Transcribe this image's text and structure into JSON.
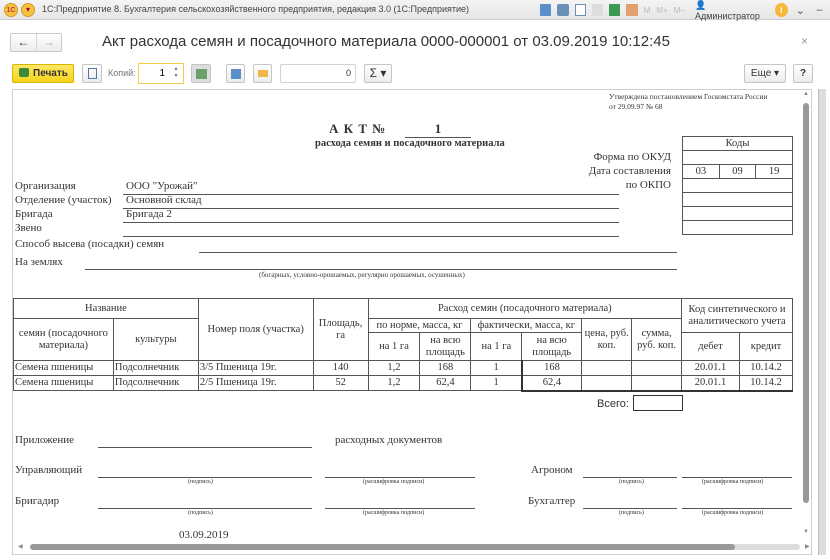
{
  "window": {
    "title": "1С:Предприятие 8. Бухгалтерия сельскохозяйственного предприятия, редакция 3.0  (1С:Предприятие)",
    "user": "Администратор",
    "m": "M",
    "m_plus": "M+",
    "m_minus": "M−"
  },
  "nav": {
    "back": "←",
    "forward": "→"
  },
  "document": {
    "title": "Акт расхода семян и посадочного материала 0000-000001 от 03.09.2019 10:12:45",
    "close": "×"
  },
  "toolbar": {
    "print_label": "Печать",
    "copies_label": "Копий:",
    "copies_value": "1",
    "sum_value": "0",
    "sigma": "Σ ▾",
    "more_label": "Еще ▾",
    "help_label": "?"
  },
  "form": {
    "approval_line1": "Утверждена постановлением Госкомстата России",
    "approval_line2": "от 29.09.97 № 68",
    "act_label": "А К Т №",
    "act_number": "1",
    "subtitle": "расхода семян и посадочного материала",
    "codes_header": "Коды",
    "okud_label": "Форма по ОКУД",
    "date_label": "Дата составления",
    "okpo_label": "по ОКПО",
    "date_day": "03",
    "date_month": "09",
    "date_year": "19",
    "org_label": "Организация",
    "org_value": "ООО \"Урожай\"",
    "dept_label": "Отделение (участок)",
    "dept_value": "Основной склад",
    "brigade_label": "Бригада",
    "brigade_value": "Бригада 2",
    "link_label": "Звено",
    "method_label": "Способ высева (посадки) семян",
    "lands_label": "На землях",
    "lands_hint": "(богарных, условно-орошаемых, регулярно орошаемых, осушенных)"
  },
  "table": {
    "h_name": "Название",
    "h_seeds": "семян (посадочного материала)",
    "h_culture": "культуры",
    "h_field": "Номер поля (участка)",
    "h_area": "Площадь, га",
    "h_consumption": "Расход семян (посадочного материала)",
    "h_norm": "по норме, масса, кг",
    "h_fact": "фактически, масса, кг",
    "h_per_ha": "на 1 га",
    "h_total_area": "на всю площадь",
    "h_price": "цена, руб. коп.",
    "h_sum": "сумма, руб. коп.",
    "h_accounts": "Код синтетического и аналитического учета",
    "h_debit": "дебет",
    "h_credit": "кредит",
    "rows": [
      {
        "seeds": "Семена пшеницы",
        "culture": "Подсолнечник",
        "field": "3/5 Пшеница 19г.",
        "area": "140",
        "norm_ha": "1,2",
        "norm_total": "168",
        "fact_ha": "1",
        "fact_total": "168",
        "price": "",
        "sum": "",
        "debit": "20.01.1",
        "credit": "10.14.2"
      },
      {
        "seeds": "Семена пшеницы",
        "culture": "Подсолнечник",
        "field": "2/5 Пшеница 19г.",
        "area": "52",
        "norm_ha": "1,2",
        "norm_total": "62,4",
        "fact_ha": "1",
        "fact_total": "62,4",
        "price": "",
        "sum": "",
        "debit": "20.01.1",
        "credit": "10.14.2"
      }
    ],
    "total_label": "Всего:"
  },
  "signatures": {
    "attachment_label": "Приложение",
    "attachment_suffix": "расходных документов",
    "manager_label": "Управляющий",
    "brigadier_label": "Бригадир",
    "agronomist_label": "Агроном",
    "accountant_label": "Бухгалтер",
    "sign_hint": "(подпись)",
    "decode_hint": "(расшифровка подписи)",
    "date": "03.09.2019"
  }
}
